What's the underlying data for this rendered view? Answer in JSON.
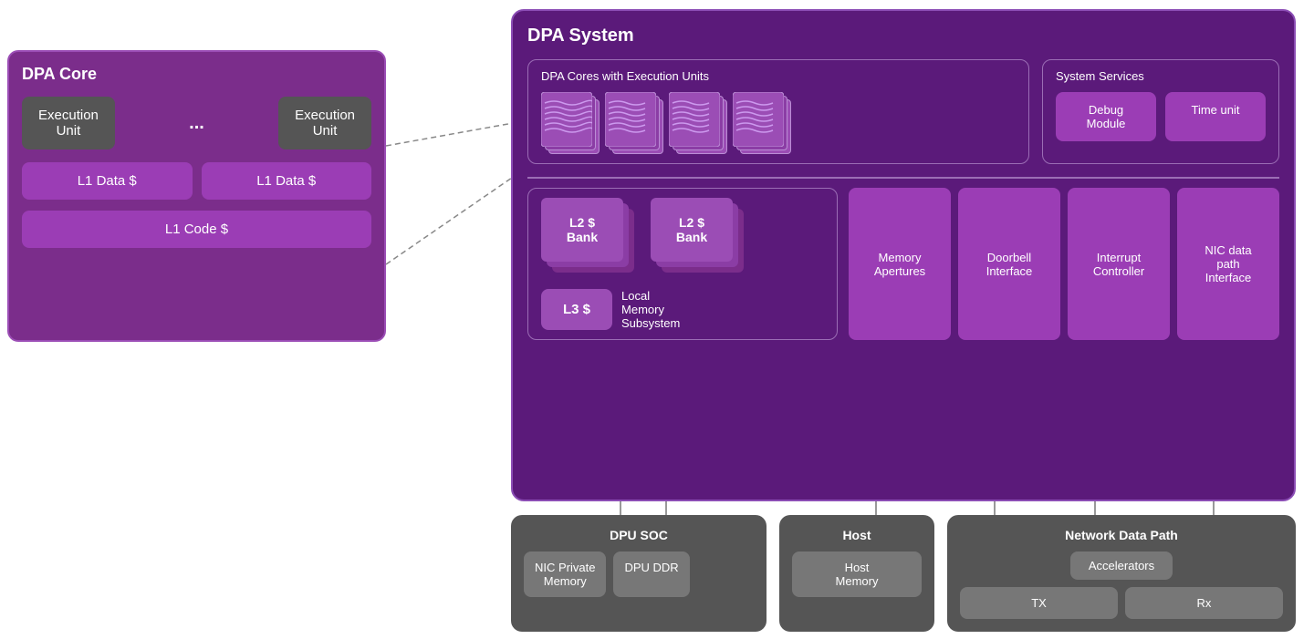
{
  "dpa_core": {
    "title": "DPA Core",
    "exec_unit_1": "Execution\nUnit",
    "exec_unit_2": "Execution\nUnit",
    "dots": "...",
    "l1_data_1": "L1 Data $",
    "l1_data_2": "L1 Data $",
    "l1_code": "L1 Code $"
  },
  "dpa_system": {
    "title": "DPA System",
    "dpa_cores_label": "DPA Cores with Execution Units",
    "system_services_label": "System Services",
    "debug_module": "Debug\nModule",
    "time_unit": "Time unit",
    "local_memory_label": "Local\nMemory\nSubsystem",
    "l2_bank_1": "L2 $\nBank",
    "l2_bank_2": "L2 $\nBank",
    "l3": "L3 $",
    "memory_apertures": "Memory\nApertures",
    "doorbell_interface": "Doorbell\nInterface",
    "interrupt_controller": "Interrupt\nController",
    "nic_datapath": "NIC data\npath\nInterface"
  },
  "bottom": {
    "dpu_soc_title": "DPU SOC",
    "nic_private_memory": "NIC Private\nMemory",
    "dpu_ddr": "DPU DDR",
    "host_title": "Host",
    "host_memory": "Host\nMemory",
    "ndp_title": "Network Data Path",
    "accelerators": "Accelerators",
    "tx": "TX",
    "rx": "Rx"
  }
}
